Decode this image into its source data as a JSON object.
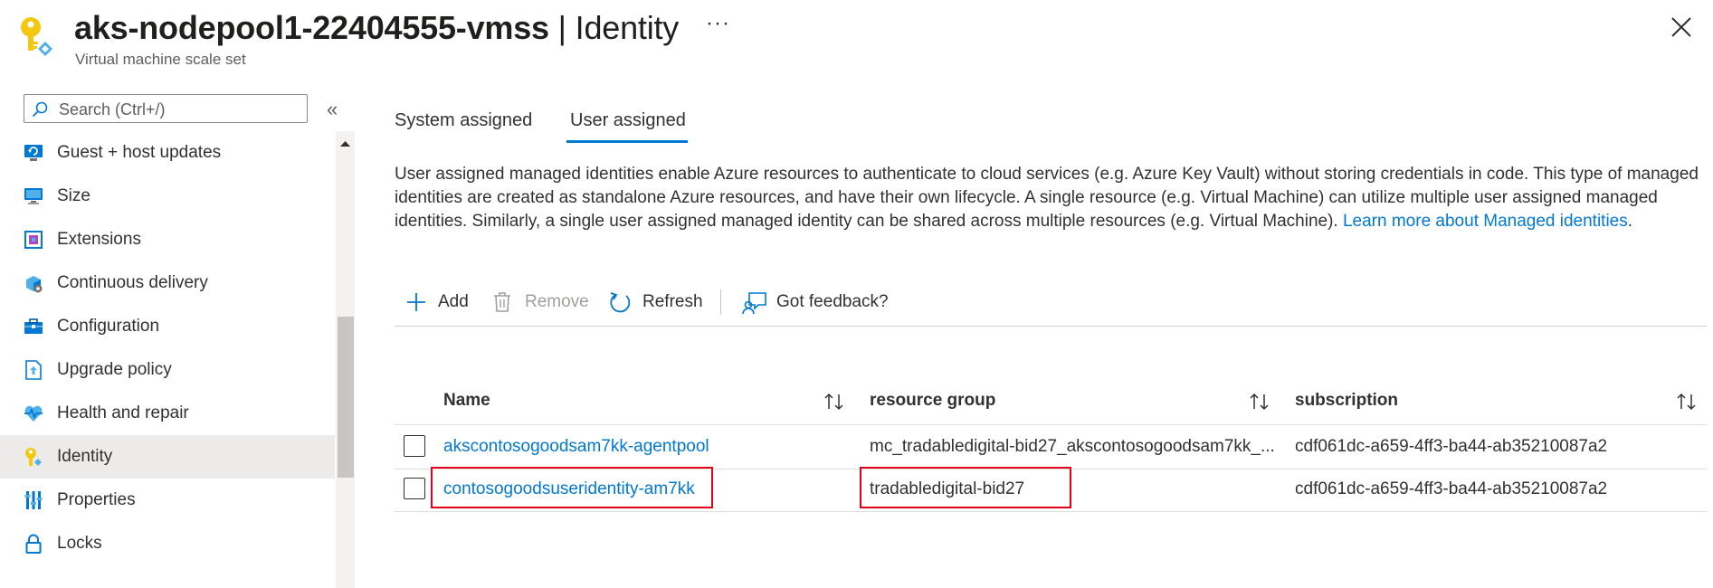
{
  "header": {
    "resource_name": "aks-nodepool1-22404555-vmss",
    "separator": " | ",
    "page_name": "Identity",
    "subtitle": "Virtual machine scale set",
    "more_label": "···",
    "icon": "key-icon"
  },
  "sidebar": {
    "search_placeholder": "Search (Ctrl+/)",
    "collapse_label": "«",
    "items": [
      {
        "label": "Guest + host updates",
        "icon": "update-icon"
      },
      {
        "label": "Size",
        "icon": "monitor-icon"
      },
      {
        "label": "Extensions",
        "icon": "extensions-icon"
      },
      {
        "label": "Continuous delivery",
        "icon": "delivery-icon"
      },
      {
        "label": "Configuration",
        "icon": "toolbox-icon"
      },
      {
        "label": "Upgrade policy",
        "icon": "upgrade-icon"
      },
      {
        "label": "Health and repair",
        "icon": "heart-pulse-icon"
      },
      {
        "label": "Identity",
        "icon": "key-icon",
        "active": true
      },
      {
        "label": "Properties",
        "icon": "properties-icon"
      },
      {
        "label": "Locks",
        "icon": "lock-icon"
      }
    ]
  },
  "tabs": [
    {
      "label": "System assigned",
      "active": false
    },
    {
      "label": "User assigned",
      "active": true
    }
  ],
  "description": {
    "text": "User assigned managed identities enable Azure resources to authenticate to cloud services (e.g. Azure Key Vault) without storing credentials in code. This type of managed identities are created as standalone Azure resources, and have their own lifecycle. A single resource (e.g. Virtual Machine) can utilize multiple user assigned managed identities. Similarly, a single user assigned managed identity can be shared across multiple resources (e.g. Virtual Machine). ",
    "link": "Learn more about Managed identities",
    "end": "."
  },
  "toolbar": {
    "add": "Add",
    "remove": "Remove",
    "refresh": "Refresh",
    "feedback": "Got feedback?"
  },
  "table": {
    "columns": [
      "Name",
      "resource group",
      "subscription"
    ],
    "rows": [
      {
        "name": "akscontosogoodsam7kk-agentpool",
        "resource_group": "mc_tradabledigital-bid27_akscontosogoodsam7kk_...",
        "subscription": "cdf061dc-a659-4ff3-ba44-ab35210087a2",
        "highlighted": false
      },
      {
        "name": "contosogoodsuseridentity-am7kk",
        "resource_group": "tradabledigital-bid27",
        "subscription": "cdf061dc-a659-4ff3-ba44-ab35210087a2",
        "highlighted": true
      }
    ]
  },
  "colors": {
    "accent": "#0078d4",
    "highlight_border": "#e3001b",
    "active_nav_bg": "#edebe9"
  }
}
